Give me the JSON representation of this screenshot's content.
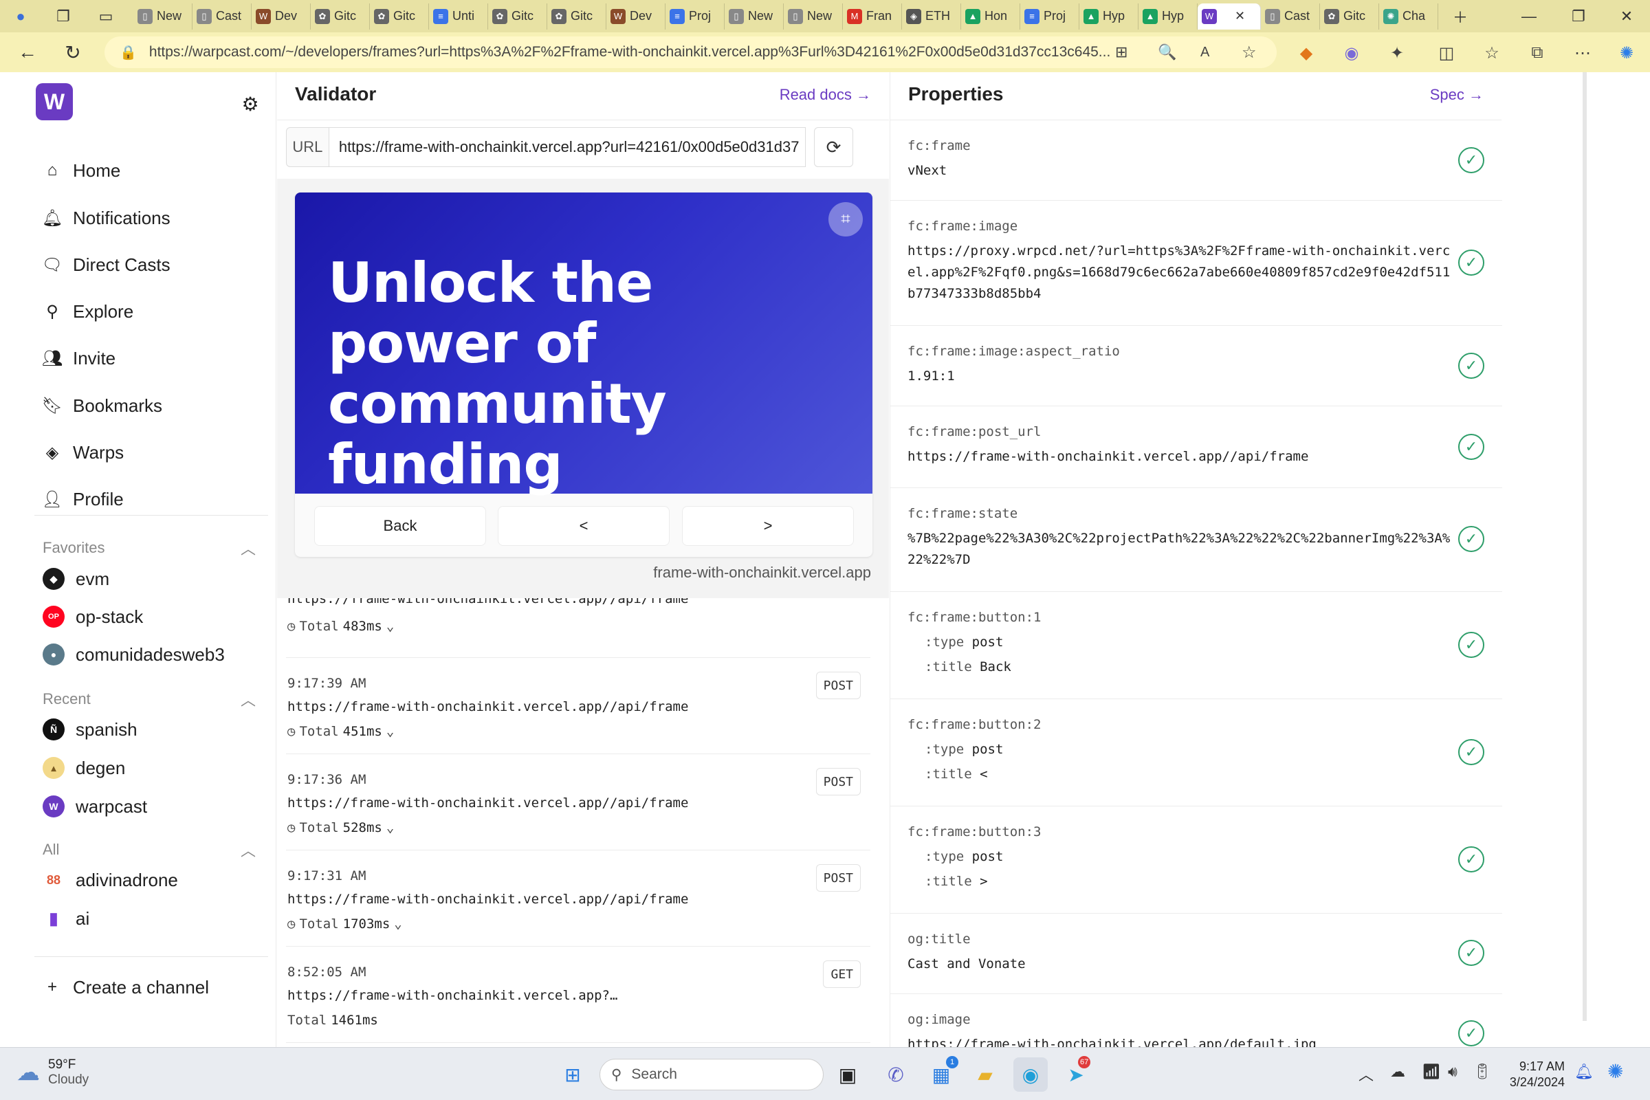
{
  "browser": {
    "tabs": [
      {
        "label": "New",
        "icon": "doc-icon",
        "color": "#888888"
      },
      {
        "label": "Cast",
        "icon": "doc-icon",
        "color": "#888888"
      },
      {
        "label": "Dev",
        "icon": "warpcast-icon",
        "color": "#8a4b2a"
      },
      {
        "label": "Gitc",
        "icon": "gitcoin-icon",
        "color": "#666666"
      },
      {
        "label": "Gitc",
        "icon": "gitcoin-icon",
        "color": "#666666"
      },
      {
        "label": "Unti",
        "icon": "docs-icon",
        "color": "#3b73e8"
      },
      {
        "label": "Gitc",
        "icon": "gitcoin-icon",
        "color": "#666666"
      },
      {
        "label": "Gitc",
        "icon": "gitcoin-icon",
        "color": "#666666"
      },
      {
        "label": "Dev",
        "icon": "warpcast-icon",
        "color": "#8a4b2a"
      },
      {
        "label": "Proj",
        "icon": "docs-icon",
        "color": "#3b73e8"
      },
      {
        "label": "New",
        "icon": "doc-icon",
        "color": "#888888"
      },
      {
        "label": "New",
        "icon": "doc-icon",
        "color": "#888888"
      },
      {
        "label": "Fran",
        "icon": "gmail-icon",
        "color": "#d93025"
      },
      {
        "label": "ETH",
        "icon": "eth-icon",
        "color": "#555555"
      },
      {
        "label": "Hon",
        "icon": "drive-icon",
        "color": "#1aa260"
      },
      {
        "label": "Proj",
        "icon": "docs-icon",
        "color": "#3b73e8"
      },
      {
        "label": "Hyp",
        "icon": "drive-icon",
        "color": "#1aa260"
      },
      {
        "label": "Hyp",
        "icon": "drive-icon",
        "color": "#1aa260"
      },
      {
        "label": "",
        "icon": "warpcast-icon",
        "color": "#6a3bc2",
        "active": true
      },
      {
        "label": "Cast",
        "icon": "doc-icon",
        "color": "#888888"
      },
      {
        "label": "Gitc",
        "icon": "gitcoin-icon",
        "color": "#666666"
      },
      {
        "label": "Cha",
        "icon": "chatgpt-icon",
        "color": "#3aa48a"
      }
    ],
    "url": "https://warpcast.com/~/developers/frames?url=https%3A%2F%2Fframe-with-onchainkit.vercel.app%3Furl%3D42161%2F0x00d5e0d31d37cc13c645..."
  },
  "sidebar": {
    "logo_letter": "W",
    "nav": [
      {
        "label": "Home",
        "icon": "home-icon"
      },
      {
        "label": "Notifications",
        "icon": "bell-icon"
      },
      {
        "label": "Direct Casts",
        "icon": "chat-icon"
      },
      {
        "label": "Explore",
        "icon": "search-icon"
      },
      {
        "label": "Invite",
        "icon": "people-icon"
      },
      {
        "label": "Bookmarks",
        "icon": "bookmark-icon"
      },
      {
        "label": "Warps",
        "icon": "diamond-icon"
      },
      {
        "label": "Profile",
        "icon": "user-icon"
      }
    ],
    "favorites_label": "Favorites",
    "favorites": [
      {
        "label": "evm",
        "color": "#1a1a1a",
        "glyph": "◆"
      },
      {
        "label": "op-stack",
        "color": "#ff0420",
        "glyph": "OP"
      },
      {
        "label": "comunidadesweb3",
        "color": "#5a7a8a",
        "glyph": "●"
      }
    ],
    "recent_label": "Recent",
    "recent": [
      {
        "label": "spanish",
        "color": "#111111",
        "glyph": "Ñ"
      },
      {
        "label": "degen",
        "color": "#f3d98a",
        "glyph": "🎩"
      },
      {
        "label": "warpcast",
        "color": "#6a3bc2",
        "glyph": "W"
      }
    ],
    "all_label": "All",
    "all": [
      {
        "label": "adivinadrone",
        "color": "#e05a3a",
        "glyph": "88"
      },
      {
        "label": "ai",
        "color": "#7b3fd8",
        "glyph": "▮"
      }
    ],
    "create_channel": "Create a channel"
  },
  "validator": {
    "title": "Validator",
    "read_docs": "Read docs",
    "url_label": "URL",
    "url_value": "https://frame-with-onchainkit.vercel.app?url=42161/0x00d5e0d31d37",
    "frame_headline": "Unlock the power of community funding",
    "buttons": [
      "Back",
      "<",
      ">"
    ],
    "domain": "frame-with-onchainkit.vercel.app",
    "logs": [
      {
        "time": "",
        "url": "https://frame-with-onchainkit.vercel.app//api/frame",
        "total_label": "Total",
        "total": "483ms",
        "method": ""
      },
      {
        "time": "9:17:39 AM",
        "url": "https://frame-with-onchainkit.vercel.app//api/frame",
        "total_label": "Total",
        "total": "451ms",
        "method": "POST"
      },
      {
        "time": "9:17:36 AM",
        "url": "https://frame-with-onchainkit.vercel.app//api/frame",
        "total_label": "Total",
        "total": "528ms",
        "method": "POST"
      },
      {
        "time": "9:17:31 AM",
        "url": "https://frame-with-onchainkit.vercel.app//api/frame",
        "total_label": "Total",
        "total": "1703ms",
        "method": "POST"
      },
      {
        "time": "8:52:05 AM",
        "url": "https://frame-with-onchainkit.vercel.app?…",
        "total_label": "Total",
        "total": "1461ms",
        "method": "GET"
      }
    ]
  },
  "properties": {
    "title": "Properties",
    "spec": "Spec",
    "items": [
      {
        "key": "fc:frame",
        "value": "vNext"
      },
      {
        "key": "fc:frame:image",
        "value": "https://proxy.wrpcd.net/?url=https%3A%2F%2Fframe-with-onchainkit.vercel.app%2F%2Fqf0.png&s=1668d79c6ec662a7abe660e40809f857cd2e9f0e42df511b77347333b8d85bb4"
      },
      {
        "key": "fc:frame:image:aspect_ratio",
        "value": "1.91:1"
      },
      {
        "key": "fc:frame:post_url",
        "value": "https://frame-with-onchainkit.vercel.app//api/frame"
      },
      {
        "key": "fc:frame:state",
        "value": "%7B%22page%22%3A30%2C%22projectPath%22%3A%22%22%2C%22bannerImg%22%3A%22%22%7D"
      },
      {
        "key": "fc:frame:button:1",
        "type_label": ":type",
        "type": "post",
        "title_label": ":title",
        "title": "Back"
      },
      {
        "key": "fc:frame:button:2",
        "type_label": ":type",
        "type": "post",
        "title_label": ":title",
        "title": "<"
      },
      {
        "key": "fc:frame:button:3",
        "type_label": ":type",
        "type": "post",
        "title_label": ":title",
        "title": ">"
      },
      {
        "key": "og:title",
        "value": "Cast and Vonate"
      },
      {
        "key": "og:image",
        "value": "https://frame-with-onchainkit.vercel.app/default.jpg"
      }
    ]
  },
  "taskbar": {
    "weather_temp": "59°F",
    "weather_desc": "Cloudy",
    "search_placeholder": "Search",
    "time": "9:17 AM",
    "date": "3/24/2024",
    "teams_badge": "1",
    "telegram_badge": "67"
  }
}
